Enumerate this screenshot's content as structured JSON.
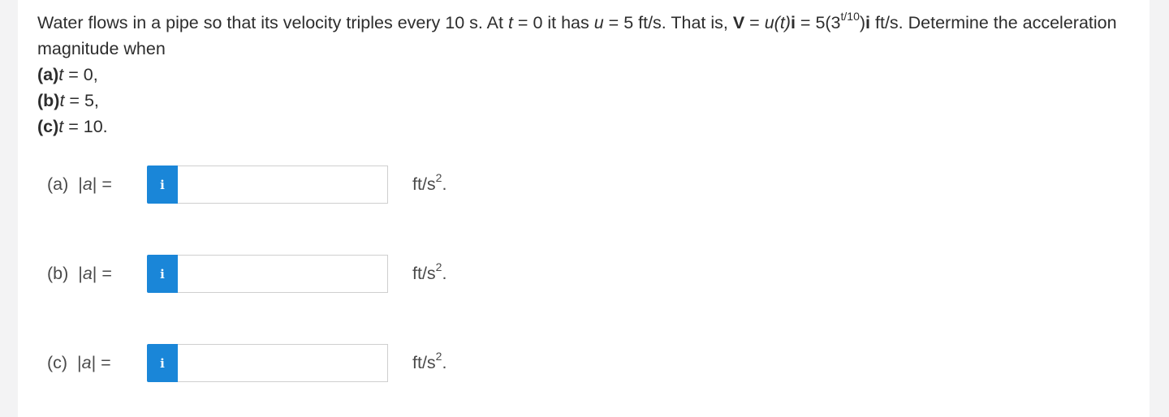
{
  "problem": {
    "intro": "Water flows in a pipe so that its velocity triples every 10 s. At ",
    "t_sym": "t",
    "cond1": " = 0 it has ",
    "u_sym": "u",
    "cond2": " = 5 ft/s. That is, ",
    "V_sym": "V",
    "eq1": " = ",
    "u_of_t": "u(t)",
    "i_sym": "i",
    "eq2": " = 5(3",
    "exponent": "t/10",
    "eq3": ")",
    "tail": " ft/s. Determine the acceleration magnitude when",
    "parts": [
      {
        "label": "(a)",
        "var": "t",
        "expr": " = 0,"
      },
      {
        "label": "(b)",
        "var": "t",
        "expr": " = 5,"
      },
      {
        "label": "(c)",
        "var": "t",
        "expr": " = 10."
      }
    ]
  },
  "answers": [
    {
      "label": "(a)",
      "prefix": "  |",
      "var": "a",
      "suffix": "| =",
      "info_icon": "i",
      "value": "",
      "unit": "ft/s",
      "unit_exp": "2",
      "unit_end": "."
    },
    {
      "label": "(b)",
      "prefix": "  |",
      "var": "a",
      "suffix": "| =",
      "info_icon": "i",
      "value": "",
      "unit": "ft/s",
      "unit_exp": "2",
      "unit_end": "."
    },
    {
      "label": "(c)",
      "prefix": "  |",
      "var": "a",
      "suffix": "| =",
      "info_icon": "i",
      "value": "",
      "unit": "ft/s",
      "unit_exp": "2",
      "unit_end": "."
    }
  ],
  "colors": {
    "accent": "#1a86d8",
    "background": "#f3f3f4",
    "panel": "#ffffff",
    "text": "#333333"
  }
}
